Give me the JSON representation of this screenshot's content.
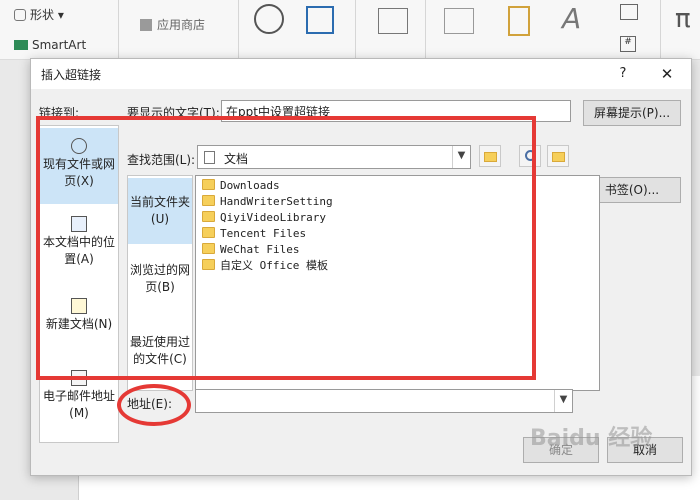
{
  "ribbon": {
    "shapes": "形状",
    "smartart": "SmartArt",
    "app_store": "应用商店"
  },
  "dialog": {
    "title": "插入超链接",
    "help": "?",
    "close": "✕",
    "link_to_label": "链接到:",
    "display_text_label": "要显示的文字(T):",
    "display_text_value": "在ppt中设置超链接",
    "screentip_button": "屏幕提示(P)...",
    "look_in_label": "查找范围(L):",
    "look_in_value": "文档",
    "bookmark_button": "书签(O)...",
    "address_label": "地址(E):",
    "address_value": "",
    "ok_button": "确定",
    "cancel_button": "取消",
    "link_targets": [
      {
        "label": "现有文件或网页(X)",
        "icon": "globe-file-icon"
      },
      {
        "label": "本文档中的位置(A)",
        "icon": "document-place-icon"
      },
      {
        "label": "新建文档(N)",
        "icon": "new-document-icon"
      },
      {
        "label": "电子邮件地址(M)",
        "icon": "email-icon"
      }
    ],
    "sub_nav": [
      {
        "label": "当前文件夹(U)"
      },
      {
        "label": "浏览过的网页(B)"
      },
      {
        "label": "最近使用过的文件(C)"
      }
    ],
    "files": [
      "Downloads",
      "HandWriterSetting",
      "QiyiVideoLibrary",
      "Tencent Files",
      "WeChat Files",
      "自定义 Office 模板"
    ]
  },
  "watermark": "Baidu 经验"
}
